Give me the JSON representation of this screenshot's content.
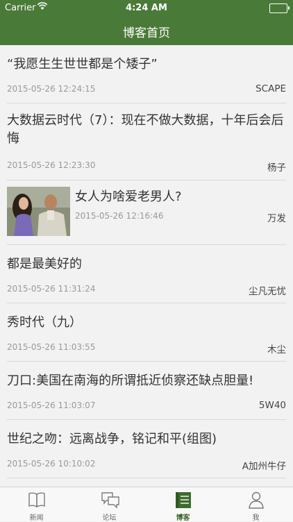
{
  "status_bar": {
    "carrier": "Carrier",
    "time": "4:24 AM"
  },
  "nav": {
    "title": "博客首页"
  },
  "posts": [
    {
      "title": "“我愿生生世世都是个矮子”",
      "date": "2015-05-26 12:24:15",
      "author": "SCAPE"
    },
    {
      "title": "大数据云时代（7）：现在不做大数据，十年后会后悔",
      "date": "2015-05-26 12:23:30",
      "author": "杨子"
    },
    {
      "title": "女人为啥爱老男人?",
      "date": "2015-05-26 12:16:46",
      "author": "万发",
      "has_thumbnail": true
    },
    {
      "title": "都是最美好的",
      "date": "2015-05-26 11:31:24",
      "author": "尘凡无忧"
    },
    {
      "title": "秀时代（九）",
      "date": "2015-05-26 11:03:55",
      "author": "木尘"
    },
    {
      "title": "刀口:美国在南海的所谓抵近侦察还缺点胆量!",
      "date": "2015-05-26 11:03:07",
      "author": "5W40"
    },
    {
      "title": "世纪之吻：远离战争，铭记和平(组图)",
      "date": "2015-05-26 10:10:02",
      "author": "A加州牛仔"
    }
  ],
  "tabs": [
    {
      "label": "新闻",
      "icon": "book-icon",
      "active": false
    },
    {
      "label": "论坛",
      "icon": "chat-bubbles-icon",
      "active": false
    },
    {
      "label": "博客",
      "icon": "notebook-icon",
      "active": true
    },
    {
      "label": "我",
      "icon": "person-icon",
      "active": false
    }
  ],
  "colors": {
    "nav_bg": "#4a7a38",
    "active_tab": "#3e6b2a",
    "background": "#f2f2f2"
  }
}
